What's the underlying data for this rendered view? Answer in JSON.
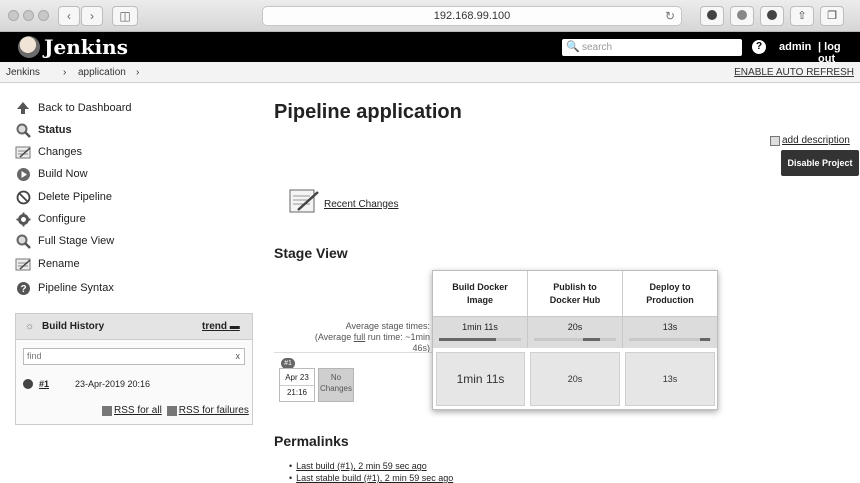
{
  "browser": {
    "url": "192.168.99.100"
  },
  "header": {
    "brand": "Jenkins",
    "search_placeholder": "search",
    "help_glyph": "?",
    "user": "admin",
    "logout": "log out"
  },
  "breadcrumb": {
    "items": [
      "Jenkins",
      "›",
      "application",
      "›"
    ],
    "auto_refresh": "ENABLE AUTO REFRESH"
  },
  "sidebar": {
    "tasks": [
      {
        "label": "Back to Dashboard",
        "icon": "up-arrow-icon",
        "bold": false
      },
      {
        "label": "Status",
        "icon": "magnifier-icon",
        "bold": true
      },
      {
        "label": "Changes",
        "icon": "notepad-icon",
        "bold": false
      },
      {
        "label": "Build Now",
        "icon": "clock-play-icon",
        "bold": false
      },
      {
        "label": "Delete Pipeline",
        "icon": "no-entry-icon",
        "bold": false
      },
      {
        "label": "Configure",
        "icon": "gear-icon",
        "bold": false
      },
      {
        "label": "Full Stage View",
        "icon": "magnifier-icon",
        "bold": false
      },
      {
        "label": "Rename",
        "icon": "notepad-icon",
        "bold": false
      },
      {
        "label": "Pipeline Syntax",
        "icon": "help-circle-icon",
        "bold": false
      }
    ]
  },
  "build_history": {
    "title": "Build History",
    "trend": "trend",
    "filter_placeholder": "find",
    "clear": "x",
    "builds": [
      {
        "number": "#1",
        "date": "23-Apr-2019 20:16"
      }
    ],
    "rss_all": "RSS for all",
    "rss_failures": "RSS for failures"
  },
  "main": {
    "title": "Pipeline application",
    "add_description": "add description",
    "disable_button": "Disable Project",
    "recent_changes": "Recent Changes",
    "stage_view_title": "Stage View",
    "avg_label_prefix": "Average stage times:",
    "avg_label_line2_a": "(Average ",
    "avg_label_full": "full",
    "avg_label_line2_b": " run time: ~1min",
    "avg_label_line3": "46s)",
    "stages": [
      {
        "name_1": "Build Docker",
        "name_2": "Image",
        "avg": "1min 11s",
        "time": "1min 11s",
        "bar_fraction": 0.7
      },
      {
        "name_1": "Publish to",
        "name_2": "Docker Hub",
        "avg": "20s",
        "time": "20s",
        "bar_fraction": 0.2
      },
      {
        "name_1": "Deploy to",
        "name_2": "Production",
        "avg": "13s",
        "time": "13s",
        "bar_fraction": 0.13
      }
    ],
    "build": {
      "badge": "#1",
      "date": "Apr 23",
      "time": "21:16",
      "changes_1": "No",
      "changes_2": "Changes"
    },
    "permalinks_title": "Permalinks",
    "permalinks": [
      "Last build (#1), 2 min 59 sec ago",
      "Last stable build (#1), 2 min 59 sec ago"
    ]
  }
}
